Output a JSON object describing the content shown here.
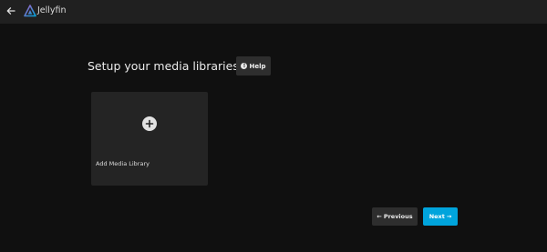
{
  "app": {
    "title": "Jellyfin"
  },
  "page": {
    "heading": "Setup your media libraries",
    "help_label": "Help",
    "help_icon_glyph": "!"
  },
  "library_card": {
    "label": "Add Media Library",
    "icon": "plus-icon"
  },
  "nav": {
    "previous_label": "Previous",
    "next_label": "Next",
    "previous_arrow": "←",
    "next_arrow": "→"
  },
  "colors": {
    "accent": "#00a4dc",
    "background": "#101010",
    "header": "#202020",
    "card": "#242424"
  }
}
